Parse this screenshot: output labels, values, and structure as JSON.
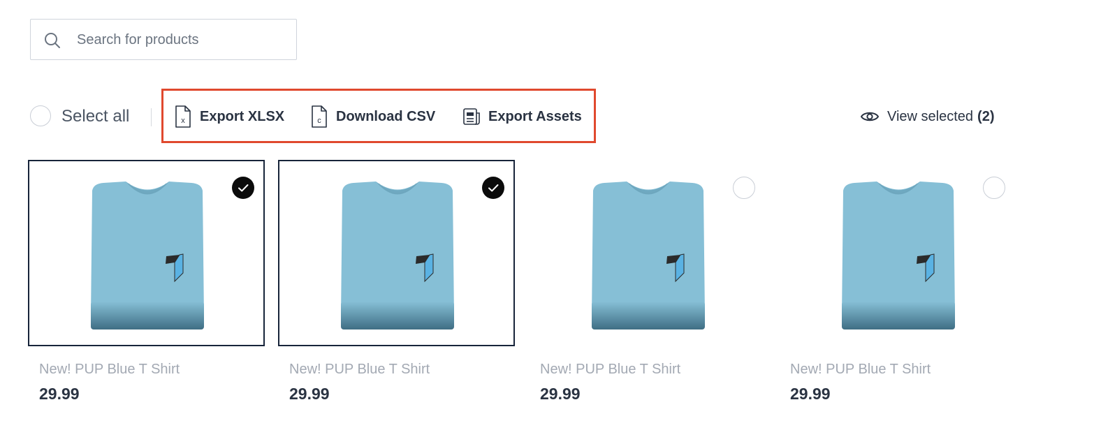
{
  "search": {
    "placeholder": "Search for products",
    "value": ""
  },
  "toolbar": {
    "select_all_label": "Select all",
    "actions": [
      {
        "label": "Export XLSX",
        "icon": "file-xlsx-icon"
      },
      {
        "label": "Download CSV",
        "icon": "file-csv-icon"
      },
      {
        "label": "Export Assets",
        "icon": "assets-document-icon"
      }
    ],
    "view_selected": {
      "label": "View selected",
      "count": "(2)",
      "icon": "eye-icon"
    },
    "highlight_color": "#e0492e"
  },
  "products": [
    {
      "title": "New! PUP Blue T Shirt",
      "price": "29.99",
      "selected": true
    },
    {
      "title": "New! PUP Blue T Shirt",
      "price": "29.99",
      "selected": true
    },
    {
      "title": "New! PUP Blue T Shirt",
      "price": "29.99",
      "selected": false
    },
    {
      "title": "New! PUP Blue T Shirt",
      "price": "29.99",
      "selected": false
    }
  ],
  "colors": {
    "shirt": "#86bfd6",
    "selected_border": "#17243a",
    "text_dark": "#2a3342",
    "text_muted": "#a3a9b3"
  }
}
